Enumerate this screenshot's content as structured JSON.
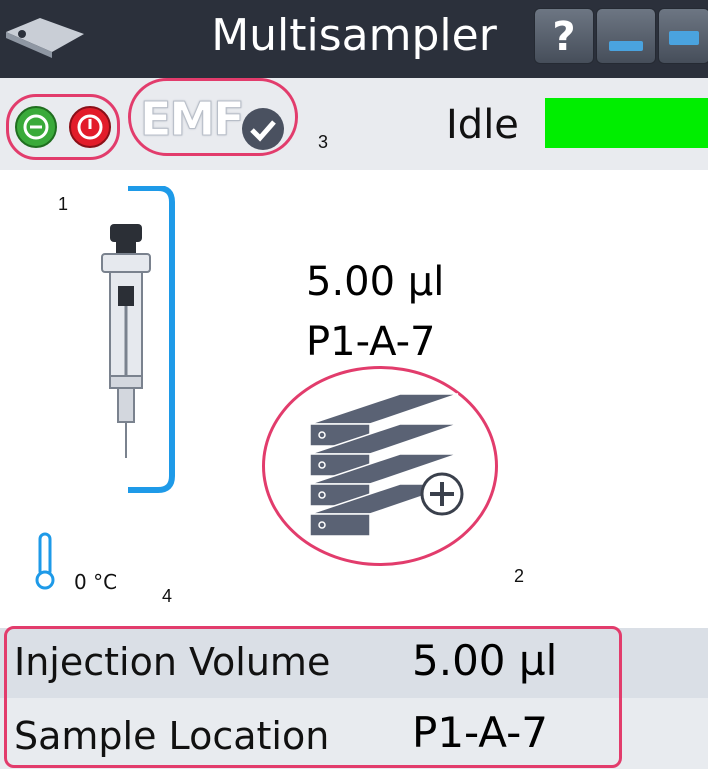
{
  "window": {
    "title": "Multisampler",
    "help_glyph": "?"
  },
  "toolbar": {
    "standby_icon": "standby-icon",
    "power_icon": "power-icon",
    "emf_label": "EMF",
    "status_text": "Idle",
    "status_color": "#00ee00"
  },
  "sampler": {
    "volume": "5.00 µl",
    "location": "P1-A-7",
    "temperature": "0 °C"
  },
  "callouts": {
    "c1": "1",
    "c2": "2",
    "c3": "3",
    "c4": "4"
  },
  "info": {
    "injection_volume_label": "Injection Volume",
    "injection_volume_value": "5.00 µl",
    "sample_location_label": "Sample Location",
    "sample_location_value": "P1-A-7"
  },
  "colors": {
    "accent_blue": "#1e9ae8",
    "callout": "#e23c6c",
    "tray": "#5a6274"
  }
}
